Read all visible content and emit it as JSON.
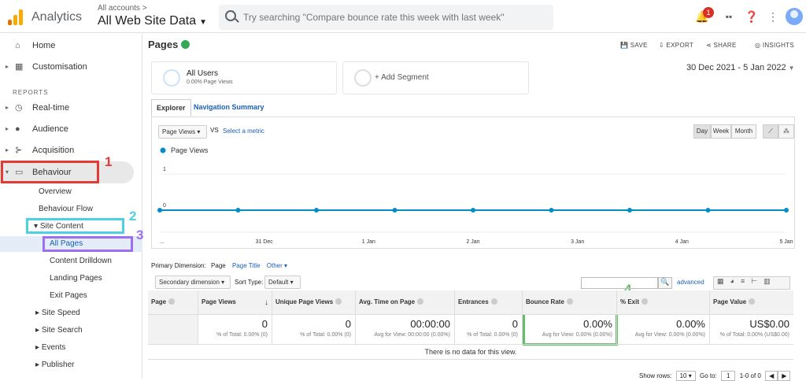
{
  "topbar": {
    "app_title": "Analytics",
    "account_small": "All accounts >",
    "account_main": "All Web Site Data",
    "search_placeholder": "Try searching \"Compare bounce rate this week with last week\"",
    "notification_count": "1"
  },
  "sidebar": {
    "home": "Home",
    "customisation": "Customisation",
    "reports_header": "REPORTS",
    "realtime": "Real-time",
    "audience": "Audience",
    "acquisition": "Acquisition",
    "behaviour": "Behaviour",
    "overview": "Overview",
    "behaviour_flow": "Behaviour Flow",
    "site_content": "Site Content",
    "all_pages": "All Pages",
    "content_drilldown": "Content Drilldown",
    "landing_pages": "Landing Pages",
    "exit_pages": "Exit Pages",
    "site_speed": "Site Speed",
    "site_search": "Site Search",
    "events": "Events",
    "publisher": "Publisher"
  },
  "annotations": {
    "a1": "1",
    "a2": "2",
    "a3": "3",
    "a4": "4"
  },
  "colors": {
    "accent": "#1a73e8",
    "line": "#058dc7",
    "red": "#e53935",
    "cyan": "#4dd0e1",
    "purple": "#9c6ef0",
    "green": "#66bb6a"
  },
  "report": {
    "title": "Pages",
    "save": "SAVE",
    "export": "EXPORT",
    "share": "SHARE",
    "insights": "INSIGHTS",
    "segment_title": "All Users",
    "segment_sub": "0.00% Page Views",
    "add_segment": "+ Add Segment",
    "date_range": "30 Dec 2021 - 5 Jan 2022",
    "tab_explorer": "Explorer",
    "tab_navigation": "Navigation Summary",
    "metric": "Page Views",
    "vs": "VS",
    "select_metric": "Select a metric",
    "day": "Day",
    "week": "Week",
    "month": "Month"
  },
  "chart_data": {
    "type": "line",
    "series": [
      {
        "name": "Page Views",
        "values": [
          0,
          0,
          0,
          0,
          0,
          0,
          0,
          0,
          0
        ]
      }
    ],
    "x": [
      "...",
      "",
      "31 Dec",
      "",
      "1 Jan",
      "",
      "2 Jan",
      "",
      "3 Jan",
      "",
      "4 Jan",
      "",
      "5 Jan"
    ],
    "y_ticks": [
      "1",
      "0"
    ],
    "ylim": [
      0,
      1
    ],
    "grid": true,
    "legend": "top-left"
  },
  "dimension": {
    "label": "Primary Dimension:",
    "page": "Page",
    "page_title": "Page Title",
    "other": "Other",
    "secondary": "Secondary dimension",
    "sort_type": "Sort Type:",
    "default": "Default",
    "advanced": "advanced"
  },
  "table": {
    "headers": [
      "Page",
      "Page Views",
      "Unique Page Views",
      "Avg. Time on Page",
      "Entrances",
      "Bounce Rate",
      "% Exit",
      "Page Value"
    ],
    "totals": [
      "0",
      "0",
      "00:00:00",
      "0",
      "0.00%",
      "0.00%",
      "US$0.00"
    ],
    "subtotals": [
      "% of Total: 0.00% (0)",
      "% of Total: 0.00% (0)",
      "Avg for View: 00:00:00 (0.00%)",
      "% of Total: 0.00% (0)",
      "Avg for View: 0.00% (0.00%)",
      "Avg for View: 0.00% (0.00%)",
      "% of Total: 0.00% (US$0.00)"
    ],
    "no_data": "There is no data for this view."
  },
  "pagination": {
    "show_rows": "Show rows:",
    "rows": "10",
    "goto": "Go to:",
    "page": "1",
    "range": "1-0 of 0"
  }
}
